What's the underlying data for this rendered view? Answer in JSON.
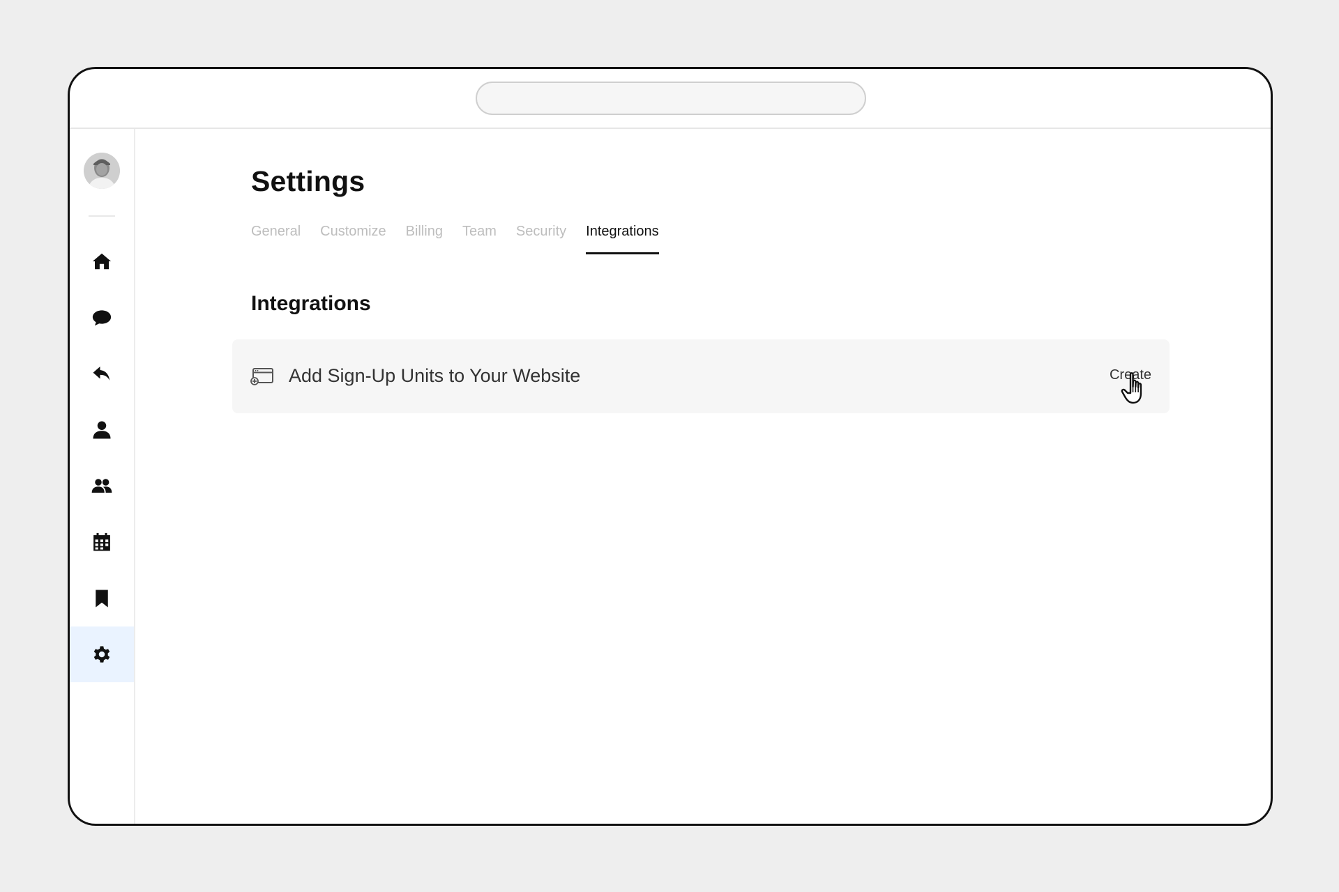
{
  "settings": {
    "title": "Settings",
    "tabs": [
      {
        "label": "General",
        "active": false
      },
      {
        "label": "Customize",
        "active": false
      },
      {
        "label": "Billing",
        "active": false
      },
      {
        "label": "Team",
        "active": false
      },
      {
        "label": "Security",
        "active": false
      },
      {
        "label": "Integrations",
        "active": true
      }
    ]
  },
  "integrations": {
    "heading": "Integrations",
    "items": [
      {
        "icon": "browser-window-add-icon",
        "title": "Add Sign-Up Units to Your Website",
        "action_label": "Create"
      }
    ]
  },
  "sidebar": {
    "avatar_icon": "user-avatar",
    "items": [
      {
        "icon": "home-icon",
        "active": false
      },
      {
        "icon": "chat-bubble-icon",
        "active": false
      },
      {
        "icon": "reply-arrow-icon",
        "active": false
      },
      {
        "icon": "person-icon",
        "active": false
      },
      {
        "icon": "group-icon",
        "active": false
      },
      {
        "icon": "calendar-icon",
        "active": false
      },
      {
        "icon": "bookmark-icon",
        "active": false
      },
      {
        "icon": "gear-icon",
        "active": true
      }
    ]
  },
  "colors": {
    "active_nav_bg": "#eaf3ff",
    "inactive_tab": "#bdbdbd",
    "text_primary": "#111111",
    "card_bg": "#f6f6f6"
  }
}
